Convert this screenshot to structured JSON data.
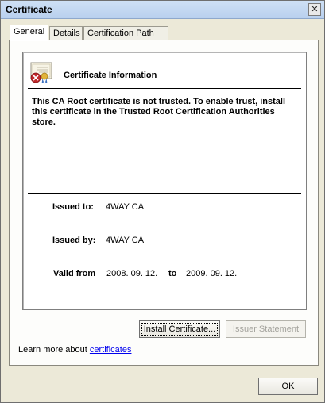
{
  "window": {
    "title": "Certificate",
    "close_glyph": "✕"
  },
  "tabs": [
    {
      "label": "General",
      "active": true
    },
    {
      "label": "Details",
      "active": false
    },
    {
      "label": "Certification Path",
      "active": false
    }
  ],
  "info": {
    "icon": "certificate-error-icon",
    "title": "Certificate Information",
    "message": "This CA Root certificate is not trusted. To enable trust, install this certificate in the Trusted Root Certification Authorities store."
  },
  "fields": {
    "issued_to_label": "Issued to:",
    "issued_to_value": "4WAY CA",
    "issued_by_label": "Issued by:",
    "issued_by_value": "4WAY CA",
    "valid_from_label": "Valid from",
    "valid_from_value": "2008. 09. 12.",
    "valid_to_label": "to",
    "valid_to_value": "2009. 09. 12."
  },
  "buttons": {
    "install": "Install Certificate...",
    "issuer": "Issuer Statement",
    "ok": "OK"
  },
  "learn_more": {
    "prefix": "Learn more about ",
    "link": "certificates"
  },
  "colors": {
    "link": "#0000ee",
    "error_badge": "#c0282b",
    "ribbon": "#e2b33a"
  }
}
